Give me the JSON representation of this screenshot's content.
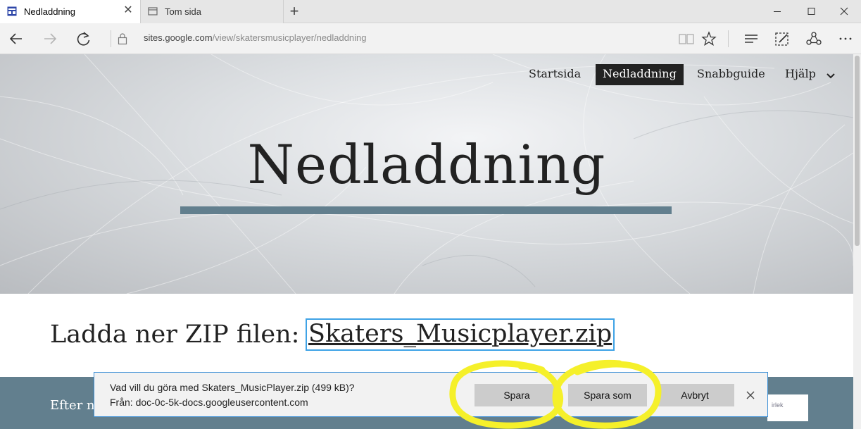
{
  "browser": {
    "tabs": [
      {
        "title": "Nedladdning",
        "active": true,
        "favicon": "page-icon"
      },
      {
        "title": "Tom sida",
        "active": false,
        "favicon": "blank-tab-icon"
      }
    ],
    "address": {
      "host": "sites.google.com",
      "path": "/view/skatersmusicplayer/nedladdning"
    }
  },
  "site": {
    "nav": [
      "Startsida",
      "Nedladdning",
      "Snabbguide",
      "Hjälp"
    ],
    "active_nav": "Nedladdning",
    "hero_title": "Nedladdning",
    "download_label": "Ladda ner ZIP filen:",
    "download_link": "Skaters_Musicplayer.zip",
    "band_text": "Efter n",
    "box_text": "irlek"
  },
  "dialog": {
    "question": "Vad vill du göra med Skaters_MusicPlayer.zip (499 kB)?",
    "source": "Från: doc-0c-5k-docs.googleusercontent.com",
    "buttons": [
      "Spara",
      "Spara som",
      "Avbryt"
    ]
  },
  "colors": {
    "accent_bar": "#627f8e",
    "highlight": "#f5f02a",
    "dialog_border": "#3b8fd6"
  }
}
